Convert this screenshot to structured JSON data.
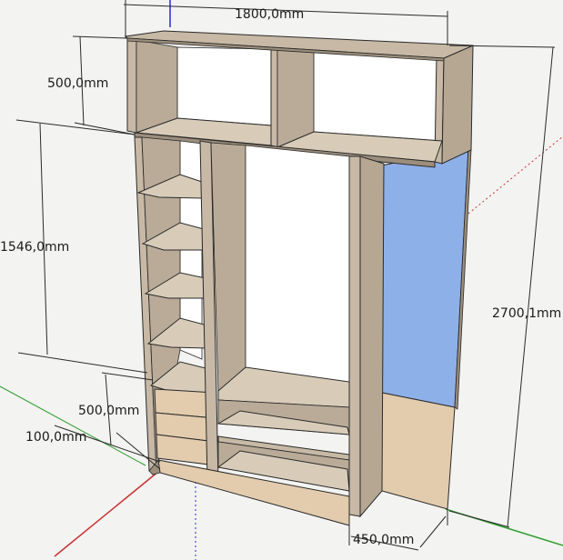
{
  "dimensions": {
    "total_width": "1800,0mm",
    "top_height": "500,0mm",
    "left_height": "1546,0mm",
    "total_height": "2700,1mm",
    "drawer_height": "500,0mm",
    "plinth_height": "100,0mm",
    "depth": "450,0mm"
  },
  "colors": {
    "wood": "#c7b9a5",
    "wood_dark": "#9c8e7c",
    "wood_light": "#d8ccb9",
    "panel_side": "#e2ccad",
    "interior_white": "#ffffff",
    "blue_panel": "#8eb0e8",
    "edge": "#2a2a2a",
    "axis_red": "#c83232",
    "axis_green": "#2e9e2e",
    "axis_blue": "#2a2ad8"
  }
}
